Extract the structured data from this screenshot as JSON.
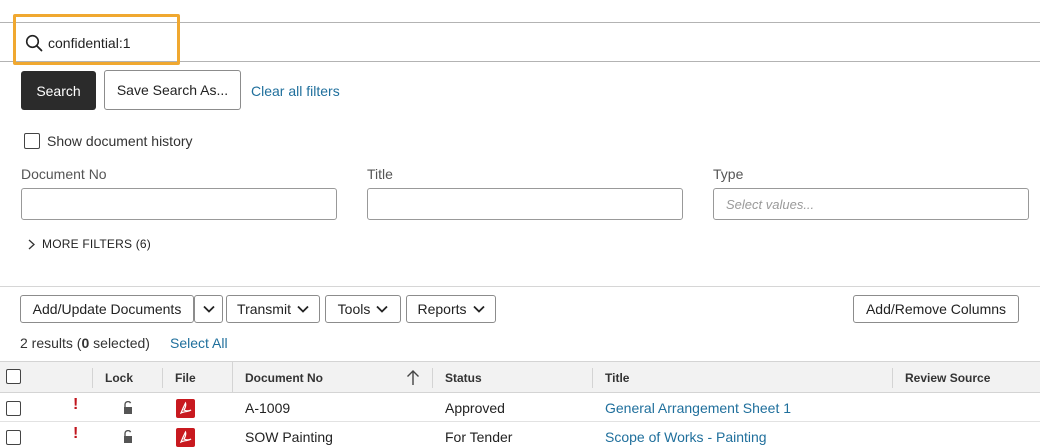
{
  "search": {
    "value": "confidential:1",
    "search_label": "Search",
    "save_search_label": "Save Search As...",
    "clear_filters_label": "Clear all filters"
  },
  "filters": {
    "show_history_label": "Show document history",
    "document_no_label": "Document No",
    "title_label": "Title",
    "type_label": "Type",
    "type_placeholder": "Select values...",
    "more_filters_label": "MORE FILTERS (6)"
  },
  "toolbar": {
    "add_update_label": "Add/Update Documents",
    "transmit_label": "Transmit",
    "tools_label": "Tools",
    "reports_label": "Reports",
    "add_remove_columns_label": "Add/Remove Columns"
  },
  "results": {
    "prefix": "2 results (",
    "selected_count": "0",
    "suffix": " selected)",
    "select_all_label": "Select All"
  },
  "table": {
    "columns": [
      "Lock",
      "File",
      "Document No",
      "Status",
      "Title",
      "Review Source"
    ],
    "rows": [
      {
        "document_no": "A-1009",
        "status": "Approved",
        "title": "General Arrangement Sheet 1",
        "flag": "!"
      },
      {
        "document_no": "SOW Painting",
        "status": "For Tender",
        "title": "Scope of Works - Painting",
        "flag": "!"
      }
    ]
  },
  "colors": {
    "primary_button": "#2b2b2b",
    "link": "#1f6f9c",
    "highlight": "#f0a830",
    "flag": "#c0151d",
    "pdf_icon": "#c8191f"
  }
}
